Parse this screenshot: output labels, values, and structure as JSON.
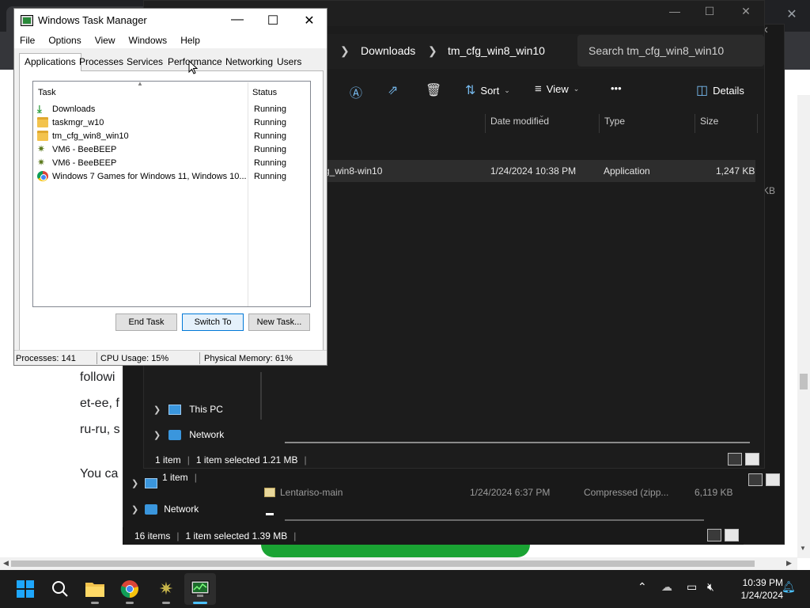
{
  "browser": {
    "new_tab": "+",
    "page_text": [
      "followi",
      "et-ee, f",
      "ru-ru, s",
      "You ca"
    ]
  },
  "explorer_back": {
    "close": "×",
    "nav": [
      {
        "label": "This PC"
      },
      {
        "label": "Network"
      }
    ],
    "file_row": {
      "name": "Lentariso-main",
      "date": "1/24/2024 6:37 PM",
      "type": "Compressed (zipp...",
      "size": "6,119 KB"
    },
    "status_items": "16 items",
    "status_selected": "1 item selected  1.39 MB",
    "status_mid": "1 item",
    "size_cut": "KB"
  },
  "explorer": {
    "window_buttons": [
      "—",
      "☐",
      "✕"
    ],
    "breadcrumb": [
      "Downloads",
      "tm_cfg_win8_win10"
    ],
    "search_placeholder": "Search tm_cfg_win8_win10",
    "toolbar": {
      "sort": "Sort",
      "view": "View",
      "more": "•••",
      "details": "Details"
    },
    "columns": {
      "date": "Date modified",
      "type": "Type",
      "size": "Size"
    },
    "row": {
      "name": "g_win8-win10",
      "date": "1/24/2024 10:38 PM",
      "type": "Application",
      "size": "1,247 KB"
    },
    "nav": [
      {
        "label": "This PC"
      },
      {
        "label": "Network"
      }
    ],
    "status_items": "1 item",
    "status_selected": "1 item selected  1.21 MB"
  },
  "taskmgr": {
    "title": "Windows Task Manager",
    "menu": [
      "File",
      "Options",
      "View",
      "Windows",
      "Help"
    ],
    "tabs": [
      "Applications",
      "Processes",
      "Services",
      "Performance",
      "Networking",
      "Users"
    ],
    "active_tab": "Applications",
    "columns": {
      "task": "Task",
      "status": "Status"
    },
    "tasks": [
      {
        "icon": "download-icon",
        "name": "Downloads",
        "status": "Running"
      },
      {
        "icon": "folder-icon",
        "name": "taskmgr_w10",
        "status": "Running"
      },
      {
        "icon": "folder-icon",
        "name": "tm_cfg_win8_win10",
        "status": "Running"
      },
      {
        "icon": "beebeep-icon",
        "name": "VM6 - BeeBEEP",
        "status": "Running"
      },
      {
        "icon": "beebeep-icon",
        "name": "VM6 - BeeBEEP",
        "status": "Running"
      },
      {
        "icon": "chrome-icon",
        "name": "Windows 7 Games for Windows 11, Windows 10...",
        "status": "Running"
      }
    ],
    "buttons": {
      "end_task": "End Task",
      "switch_to": "Switch To",
      "new_task": "New Task..."
    },
    "status": {
      "processes": "Processes: 141",
      "cpu": "CPU Usage: 15%",
      "memory": "Physical Memory: 61%"
    }
  },
  "taskbar": {
    "clock_time": "10:39 PM",
    "clock_date": "1/24/2024"
  }
}
